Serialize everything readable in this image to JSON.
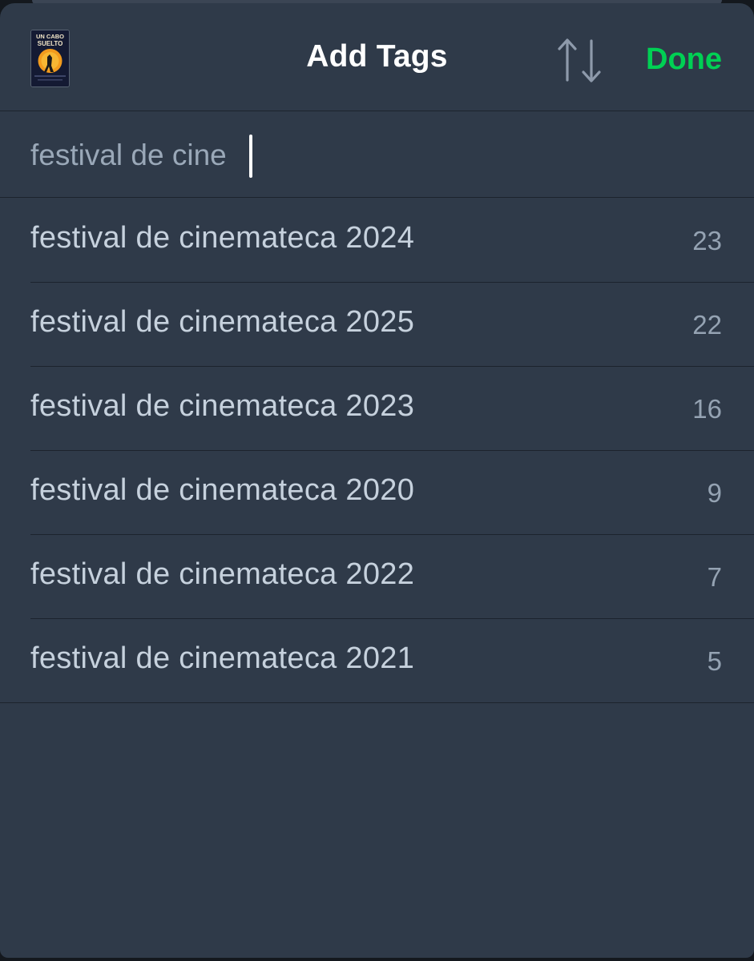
{
  "header": {
    "title": "Add Tags",
    "done_label": "Done",
    "poster_text_top": "UN CABO",
    "poster_text_bottom": "SUELTO",
    "poster_icon": "film-poster-icon",
    "sort_icon": "sort-arrows-icon"
  },
  "search": {
    "value": "festival de cine",
    "placeholder": ""
  },
  "tags": [
    {
      "name": "festival de cinemateca 2024",
      "count": "23"
    },
    {
      "name": "festival de cinemateca 2025",
      "count": "22"
    },
    {
      "name": "festival de cinemateca 2023",
      "count": "16"
    },
    {
      "name": "festival de cinemateca 2020",
      "count": "9"
    },
    {
      "name": "festival de cinemateca 2022",
      "count": "7"
    },
    {
      "name": "festival de cinemateca 2021",
      "count": "5"
    }
  ],
  "colors": {
    "background": "#2f3a49",
    "accent": "#00d054",
    "title": "#ffffff",
    "tag_text": "#c6d1dd",
    "count_text": "#95a3b3"
  }
}
